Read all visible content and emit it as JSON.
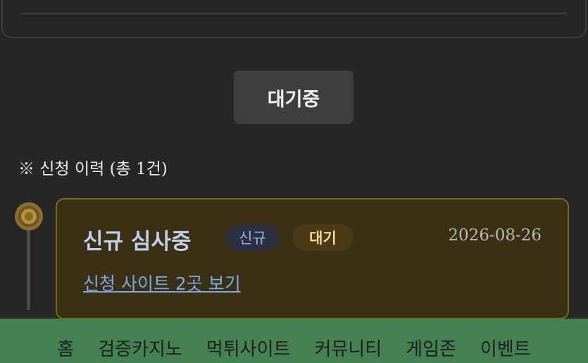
{
  "status_button": {
    "label": "대기중"
  },
  "history": {
    "title": "※ 신청 이력 (총 1건)",
    "items": [
      {
        "title": "신규 심사중",
        "badges": [
          "신규",
          "대기"
        ],
        "date": "2026-08-26",
        "link": "신청 사이트 2곳 보기"
      }
    ]
  },
  "bottom_nav": {
    "items": [
      "홈",
      "검증카지노",
      "먹튀사이트",
      "커뮤니티",
      "게임존",
      "이벤트"
    ]
  },
  "colors": {
    "background": "#262626",
    "card_bg": "#3b2f14",
    "card_border": "#7f6628",
    "nav_bg": "#458152",
    "link": "#7ba9e6"
  }
}
